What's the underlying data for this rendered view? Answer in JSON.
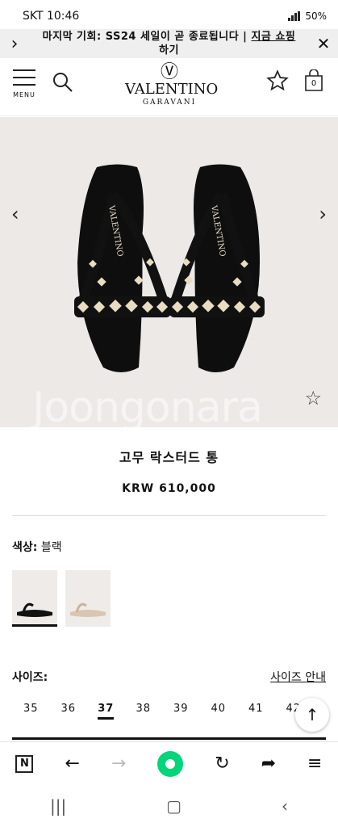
{
  "status": {
    "carrier_time": "SKT 10:46",
    "battery": "50%"
  },
  "promo": {
    "text": "마지막 기회: SS24 세일이 곧 종료됩니다 | ",
    "link": "지금 쇼핑",
    "text2": "하기"
  },
  "header": {
    "menu_label": "MENU",
    "brand": "VALENTINO",
    "brand_sub": "GARAVANI",
    "bag_count": "0"
  },
  "hero": {
    "watermark": "Joongonara"
  },
  "product": {
    "title": "고무 락스터드 통",
    "price": "KRW 610,000"
  },
  "color": {
    "label": "색상:",
    "value": "블랙"
  },
  "size": {
    "label": "사이즈:",
    "guide": "사이즈 안내",
    "options": [
      "35",
      "36",
      "37",
      "38",
      "39",
      "40",
      "41",
      "42"
    ],
    "selected": "37"
  }
}
